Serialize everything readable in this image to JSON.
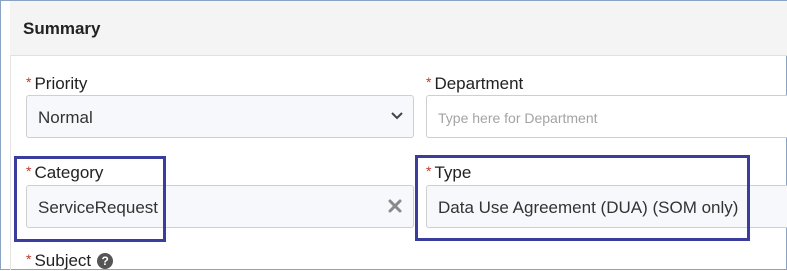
{
  "panel": {
    "title": "Summary"
  },
  "fields": {
    "priority": {
      "required_mark": "*",
      "label": "Priority",
      "value": "Normal"
    },
    "department": {
      "required_mark": "*",
      "label": "Department",
      "placeholder": "Type here for Department"
    },
    "category": {
      "required_mark": "*",
      "label": "Category",
      "value": "ServiceRequest"
    },
    "type": {
      "required_mark": "*",
      "label": "Type",
      "value": "Data Use Agreement (DUA) (SOM only)"
    },
    "subject": {
      "required_mark": "*",
      "label": "Subject",
      "help_icon": "?"
    }
  },
  "icons": {
    "dropdown": "chevron-down-icon",
    "clear": "close-icon",
    "help": "question-circle-icon"
  },
  "colors": {
    "required": "#c0392b",
    "highlight_box": "#3b3d9c",
    "header_bg": "#f4f4f4"
  }
}
